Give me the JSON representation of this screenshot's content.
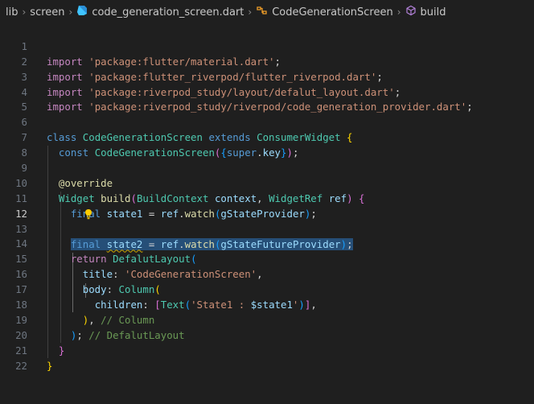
{
  "breadcrumb": {
    "items": [
      "lib",
      "screen",
      "code_generation_screen.dart",
      "CodeGenerationScreen",
      "build"
    ]
  },
  "editor": {
    "active_line": 12,
    "line_numbers": [
      "1",
      "2",
      "3",
      "4",
      "5",
      "6",
      "7",
      "8",
      "9",
      "10",
      "11",
      "12",
      "13",
      "14",
      "15",
      "16",
      "17",
      "18",
      "19",
      "20",
      "21",
      "22"
    ],
    "lines": {
      "l1": [
        "import",
        " ",
        "'package:flutter/material.dart'",
        ";"
      ],
      "l2": [
        "import",
        " ",
        "'package:flutter_riverpod/flutter_riverpod.dart'",
        ";"
      ],
      "l3": [
        "import",
        " ",
        "'package:riverpod_study/layout/defalut_layout.dart'",
        ";"
      ],
      "l4": [
        "import",
        " ",
        "'package:riverpod_study/riverpod/code_generation_provider.dart'",
        ";"
      ],
      "l6": [
        "class",
        " ",
        "CodeGenerationScreen",
        " ",
        "extends",
        " ",
        "ConsumerWidget",
        " ",
        "{"
      ],
      "l7": [
        "const",
        " ",
        "CodeGenerationScreen",
        "(",
        "{",
        "super",
        ".",
        "key",
        "}",
        ")",
        ";"
      ],
      "l9": [
        "@override"
      ],
      "l10": [
        "Widget",
        " ",
        "build",
        "(",
        "BuildContext",
        " ",
        "context",
        ", ",
        "WidgetRef",
        " ",
        "ref",
        ")",
        " ",
        "{"
      ],
      "l11": [
        "final",
        " ",
        "state1",
        " = ",
        "ref",
        ".",
        "watch",
        "(",
        "gStateProvider",
        ")",
        ";"
      ],
      "l12": [
        "final",
        " ",
        "state2",
        " = ",
        "ref",
        ".",
        "watch",
        "(",
        "gStateFutureProvider",
        ")",
        ";"
      ],
      "l14": [
        "return",
        " ",
        "DefalutLayout",
        "("
      ],
      "l15": [
        "title",
        ": ",
        "'CodeGenerationScreen'",
        ","
      ],
      "l16": [
        "body",
        ": ",
        "Column",
        "("
      ],
      "l17": [
        "children",
        ": ",
        "[",
        "Text",
        "(",
        "'State1 : ",
        "$state1",
        "'",
        ")",
        "]",
        ","
      ],
      "l18": [
        ")",
        ", ",
        "// Column"
      ],
      "l19": [
        ")",
        "; ",
        "// DefalutLayout"
      ],
      "l20": [
        "}"
      ],
      "l21": [
        "}"
      ]
    }
  },
  "colors": {
    "background": "#1f1f1f",
    "keyword": "#569cd6",
    "control_keyword": "#c586c0",
    "string": "#ce9178",
    "class": "#4ec9b0",
    "function": "#dcdcaa",
    "variable": "#9cdcfe",
    "comment": "#6a9955",
    "selection": "#264f78"
  }
}
